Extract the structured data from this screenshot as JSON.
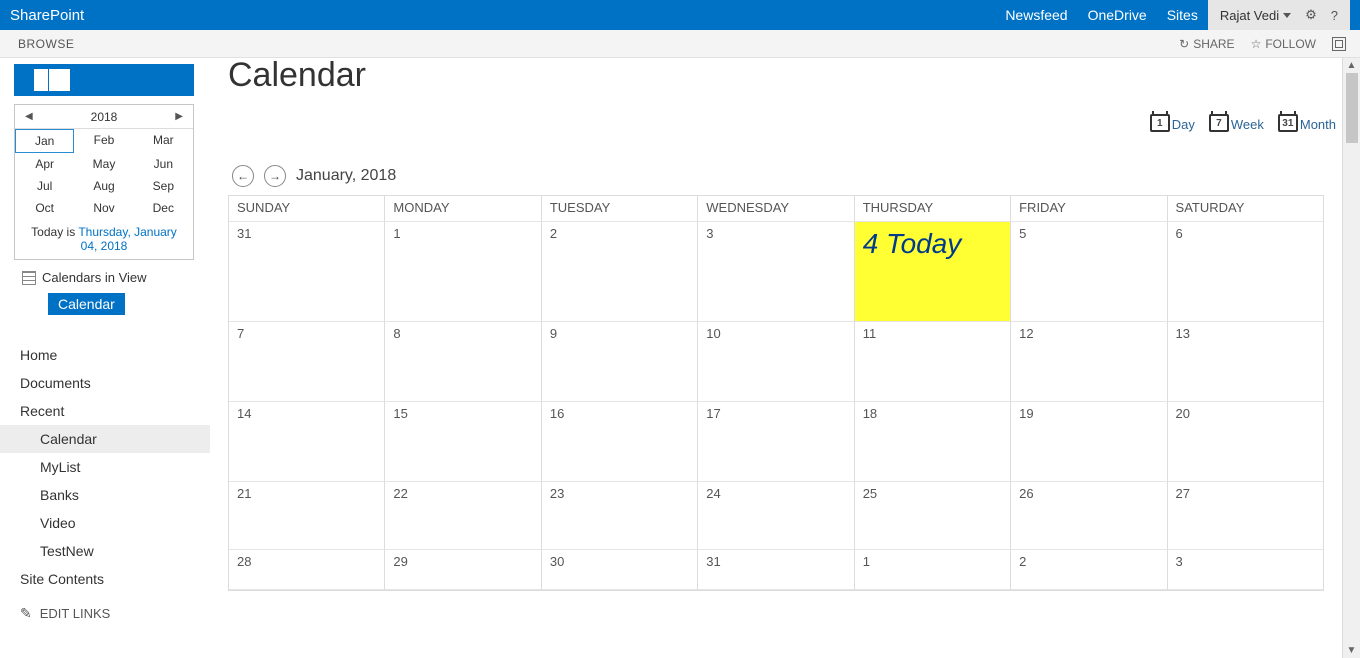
{
  "suite": {
    "brand": "SharePoint",
    "links": [
      "Newsfeed",
      "OneDrive",
      "Sites"
    ],
    "user": "Rajat Vedi"
  },
  "ribbon": {
    "browse": "BROWSE",
    "share": "SHARE",
    "follow": "FOLLOW"
  },
  "sidebar": {
    "datepicker": {
      "year": "2018",
      "months": [
        "Jan",
        "Feb",
        "Mar",
        "Apr",
        "May",
        "Jun",
        "Jul",
        "Aug",
        "Sep",
        "Oct",
        "Nov",
        "Dec"
      ],
      "selected": "Jan",
      "today_prefix": "Today is ",
      "today_link": "Thursday, January 04, 2018"
    },
    "calendars_in_view": "Calendars in View",
    "chip": "Calendar",
    "quicklaunch": {
      "home": "Home",
      "documents": "Documents",
      "recent": "Recent",
      "recent_items": [
        "Calendar",
        "MyList",
        "Banks",
        "Video",
        "TestNew"
      ],
      "site_contents": "Site Contents",
      "edit_links": "EDIT LINKS"
    }
  },
  "main": {
    "title": "Calendar",
    "view_switch": {
      "day": "Day",
      "week": "Week",
      "month": "Month",
      "day_n": "1",
      "week_n": "7",
      "month_n": "31"
    },
    "month_label": "January, 2018",
    "day_headers": [
      "SUNDAY",
      "MONDAY",
      "TUESDAY",
      "WEDNESDAY",
      "THURSDAY",
      "FRIDAY",
      "SATURDAY"
    ],
    "today_cell": "4 Today",
    "weeks": [
      [
        "31",
        "1",
        "2",
        "3",
        "4",
        "5",
        "6"
      ],
      [
        "7",
        "8",
        "9",
        "10",
        "11",
        "12",
        "13"
      ],
      [
        "14",
        "15",
        "16",
        "17",
        "18",
        "19",
        "20"
      ],
      [
        "21",
        "22",
        "23",
        "24",
        "25",
        "26",
        "27"
      ],
      [
        "28",
        "29",
        "30",
        "31",
        "1",
        "2",
        "3"
      ]
    ]
  }
}
